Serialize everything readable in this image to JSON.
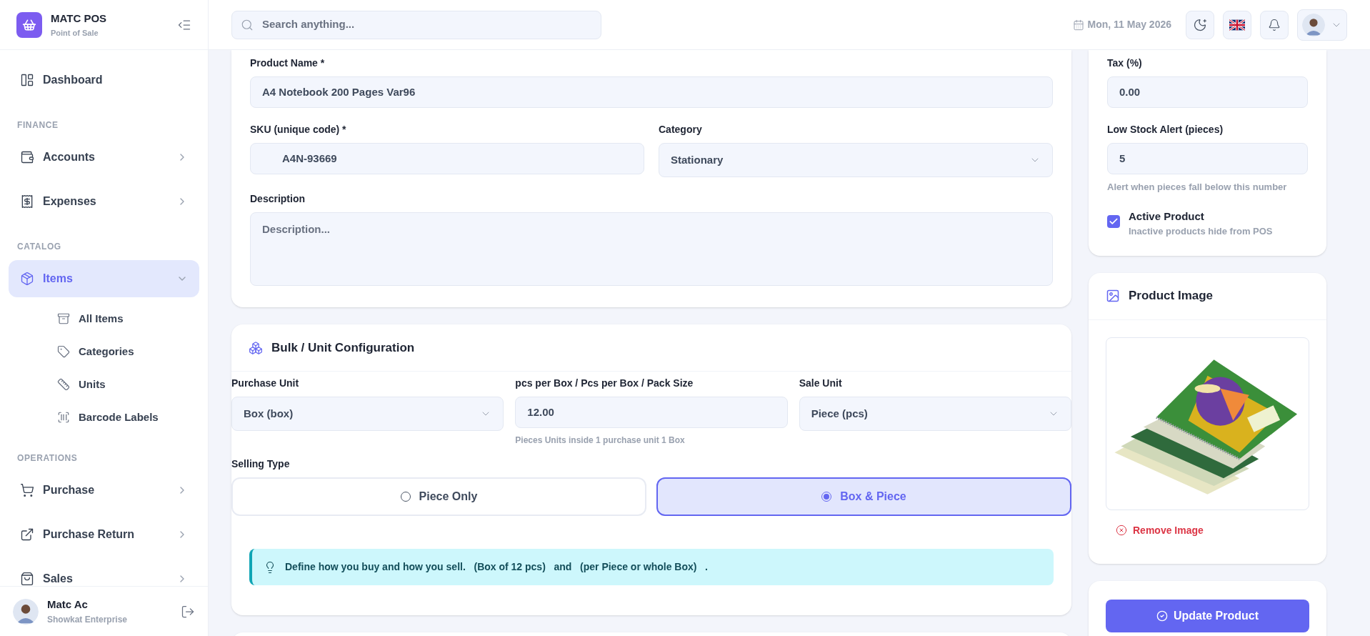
{
  "brand": {
    "name": "MATC POS",
    "subtitle": "Point of Sale"
  },
  "sidebar": {
    "sections": [
      {
        "items": [
          {
            "label": "Dashboard",
            "selected": false
          }
        ]
      },
      {
        "heading": "FINANCE",
        "items": [
          {
            "label": "Accounts",
            "selected": false,
            "expanded": false
          },
          {
            "label": "Expenses",
            "selected": false,
            "expanded": false
          }
        ]
      },
      {
        "heading": "CATALOG",
        "items": [
          {
            "label": "Items",
            "selected": true,
            "expanded": true,
            "children": [
              {
                "label": "All Items"
              },
              {
                "label": "Categories"
              },
              {
                "label": "Units"
              },
              {
                "label": "Barcode Labels"
              }
            ]
          }
        ]
      },
      {
        "heading": "OPERATIONS",
        "items": [
          {
            "label": "Purchase",
            "selected": false,
            "expanded": false
          },
          {
            "label": "Purchase Return",
            "selected": false,
            "expanded": false
          },
          {
            "label": "Sales",
            "selected": false,
            "expanded": false
          }
        ]
      }
    ]
  },
  "user": {
    "name": "Matc Ac",
    "company": "Showkat Enterprise"
  },
  "topbar": {
    "search": {
      "placeholder": "Search anything..."
    },
    "date": "Mon, 11 May 2026"
  },
  "product": {
    "name": {
      "label": "Product Name *",
      "value": "A4 Notebook 200 Pages Var96"
    },
    "sku": {
      "label": "SKU (unique code) *",
      "value": "A4N-93669"
    },
    "category": {
      "label": "Category",
      "value": "Stationary"
    },
    "description": {
      "label": "Description",
      "placeholder": "Description..."
    }
  },
  "bulk": {
    "title": "Bulk / Unit Configuration",
    "purchase_unit": {
      "label": "Purchase Unit",
      "value": "Box (box)"
    },
    "pack_size": {
      "label": "pcs per Box / Pcs per Box / Pack Size",
      "value": "12.00",
      "hint": "Pieces Units inside 1 purchase unit 1 Box"
    },
    "sale_unit": {
      "label": "Sale Unit",
      "value": "Piece (pcs)"
    },
    "selling_type": {
      "label": "Selling Type",
      "options": [
        {
          "label": "Piece Only",
          "selected": false
        },
        {
          "label": "Box & Piece",
          "selected": true
        }
      ]
    },
    "tip": "Define how you buy and how you sell.   (Box of 12 pcs)   and   (per Piece or whole Box)   ."
  },
  "settings": {
    "tax": {
      "label": "Tax (%)",
      "value": "0.00"
    },
    "low_stock": {
      "label": "Low Stock Alert (pieces)",
      "value": "5",
      "hint": "Alert when pieces fall below this number"
    },
    "active": {
      "label": "Active Product",
      "hint": "Inactive products hide from POS",
      "checked": true
    }
  },
  "image": {
    "title": "Product Image",
    "remove": "Remove Image"
  },
  "submit": "Update Product"
}
